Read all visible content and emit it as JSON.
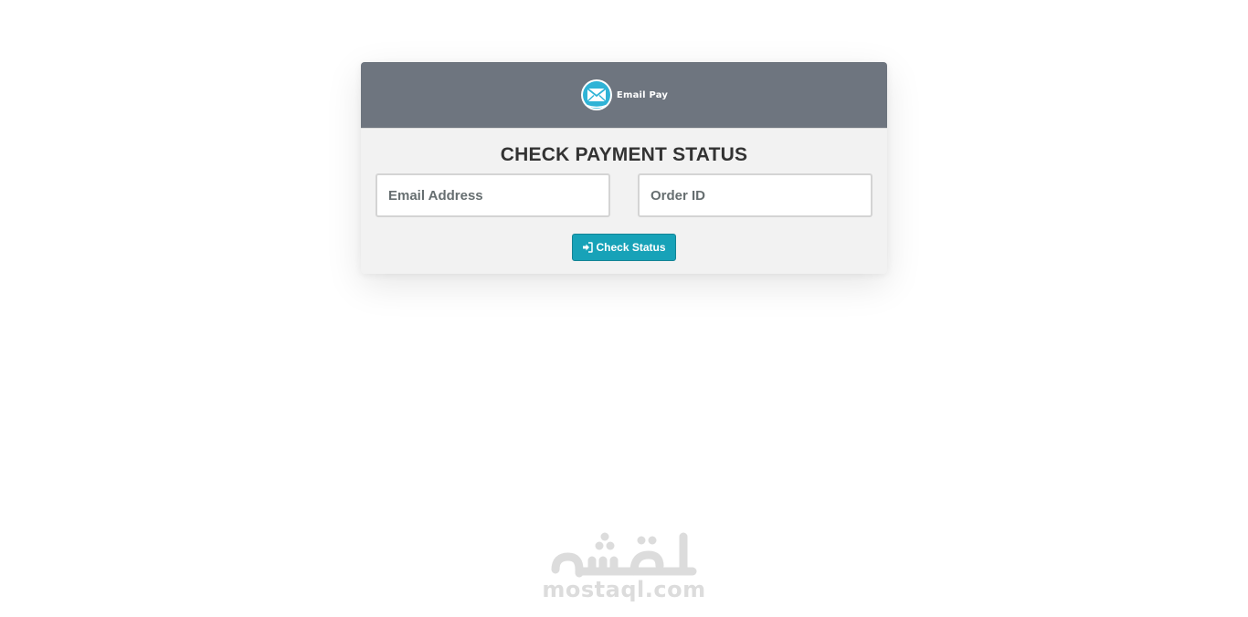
{
  "header": {
    "logo_icon": "envelope-circle-icon",
    "brand_name": "Email Pay"
  },
  "form": {
    "title": "CHECK PAYMENT STATUS",
    "email": {
      "placeholder": "Email Address",
      "value": ""
    },
    "order_id": {
      "placeholder": "Order ID",
      "value": ""
    },
    "submit": {
      "icon": "sign-in-icon",
      "label": "Check Status"
    }
  },
  "watermark": {
    "text": "mostaql.com"
  },
  "colors": {
    "header_bg": "#6e757f",
    "card_bg": "#f2f2f2",
    "button_bg": "#17a2b8",
    "logo_accent": "#2fb3d6"
  }
}
